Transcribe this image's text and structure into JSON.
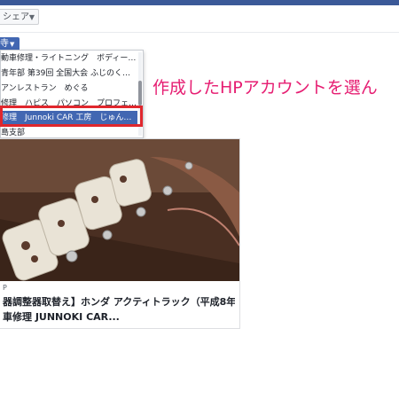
{
  "composer": {
    "share_label": "シェア",
    "post_as_label": "寺"
  },
  "dropdown": {
    "items": [
      "動車修理・ライトニング　ボディーコ...",
      "青年部 第39回 全国大会 ふじのくに静...",
      "アンレストラン　めぐる",
      "修理　ハピス　パソコン　プロフェッ...",
      "修理　Junnoki CAR 工房　じゅんの木...",
      "島支部"
    ],
    "selected_index": 4
  },
  "annotation": {
    "text": "作成したHPアカウントを選ん"
  },
  "link_card": {
    "meta": "P",
    "title_line1": "器調整器取替え】ホンダ アクティトラック（平成8年",
    "title_line2": "車修理 JUNNOKI CAR..."
  },
  "colors": {
    "facebook_blue": "#4267b2",
    "highlight_red": "#e0272d",
    "annotation_pink": "#e61e72"
  }
}
